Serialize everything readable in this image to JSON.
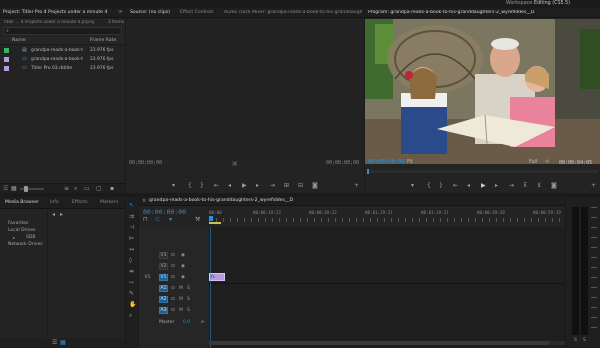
{
  "topbar": {
    "workspace_label": "Workspace:",
    "workspace_value": "Editing (CS5.5)"
  },
  "project_panel": {
    "tab_title": "Project: Titler Pro 4 Projects under a minute 4",
    "menu_glyph": "≫",
    "sub_path": "Titler ... 4 Projects under a minute 4.prproj",
    "items_count": "3 Items",
    "col_name": "Name",
    "col_rate": "Frame Rate",
    "items": [
      {
        "name": "grandpa-reads-a-book-t",
        "rate": "23.976 fps",
        "color": "#3bb35c"
      },
      {
        "name": "grandpa-reads-a-book-t",
        "rate": "23.976 fps",
        "color": "#b79be0"
      },
      {
        "name": "Titler Pro 03.rbtitle",
        "rate": "23.976 fps",
        "color": "#b79be0"
      }
    ]
  },
  "source_monitor": {
    "tabs": [
      "Source: (no clips)",
      "Effect Controls",
      "Audio Track Mixer: grandpa-reads-a-book-to-his-granddaughters-2_wyrefiddes__D"
    ],
    "tc_left": "00;00;00;00",
    "tc_right": "00;00;00;00"
  },
  "program_monitor": {
    "tab_title": "Program: grandpa-reads-a-book-to-his-granddaughters-2_wyrefiddes__D",
    "timecode": "00:00:00:00",
    "fit": "Fit",
    "quality": "Full",
    "duration": "00:00:04:05"
  },
  "media_browser": {
    "tabs": [
      "Media Browser",
      "Info",
      "Effects",
      "Markers"
    ],
    "tree": [
      "Favorites",
      "Local Drives",
      "SDB",
      "Network Drives"
    ]
  },
  "timeline": {
    "tab_title": "grandpa-reads-a-book-to-his-granddaughters-2_wyrefiddes__D",
    "timecode": "00:00:00:00",
    "ruler": [
      "00:00",
      "00:00:19:23",
      "00:00:39:22",
      "00:01:29:21",
      "00:01:39:21",
      "00:00:29:20",
      "00:00:59:19"
    ],
    "video_tracks": [
      "V3",
      "V2",
      "V1"
    ],
    "audio_tracks": [
      "A1",
      "A2",
      "A3"
    ],
    "master_label": "Master",
    "master_value": "0.0"
  }
}
